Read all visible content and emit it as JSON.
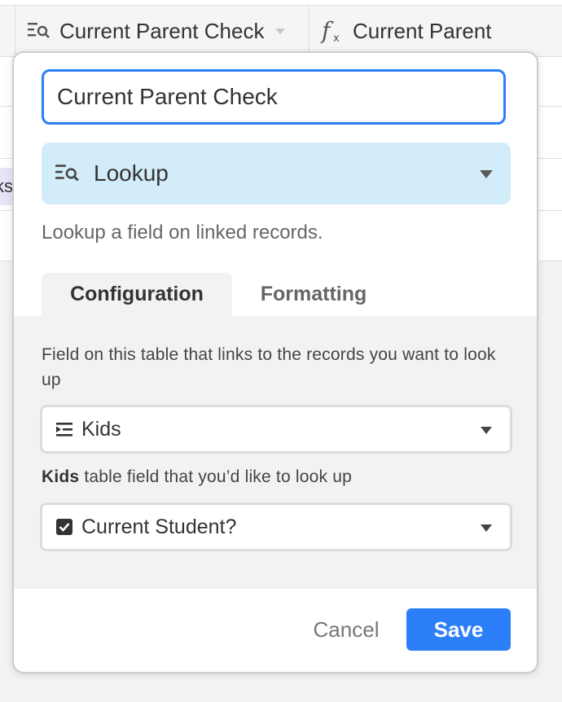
{
  "grid": {
    "columns": [
      {
        "icon": "lookup-icon",
        "label": "Current Parent Check"
      },
      {
        "icon": "formula-icon",
        "label": "Current Parent"
      }
    ],
    "partial_cell_text": "ks"
  },
  "field_editor": {
    "field_name_value": "Current Parent Check",
    "field_type": {
      "icon": "lookup-icon",
      "label": "Lookup"
    },
    "description": "Lookup a field on linked records.",
    "tabs": [
      {
        "label": "Configuration",
        "active": true
      },
      {
        "label": "Formatting",
        "active": false
      }
    ],
    "config": {
      "link_field_label": "Field on this table that links to the records you want to look up",
      "link_field_value": {
        "icon": "link-icon",
        "label": "Kids"
      },
      "lookup_field_label_bold": "Kids",
      "lookup_field_label_rest": " table field that you’d like to look up",
      "lookup_field_value": {
        "icon": "checkbox-icon",
        "label": "Current Student?"
      }
    },
    "buttons": {
      "cancel": "Cancel",
      "save": "Save"
    }
  },
  "colors": {
    "accent": "#2d7ff9",
    "type_select_bg": "#d2ecf9",
    "config_bg": "#f2f2f2"
  }
}
